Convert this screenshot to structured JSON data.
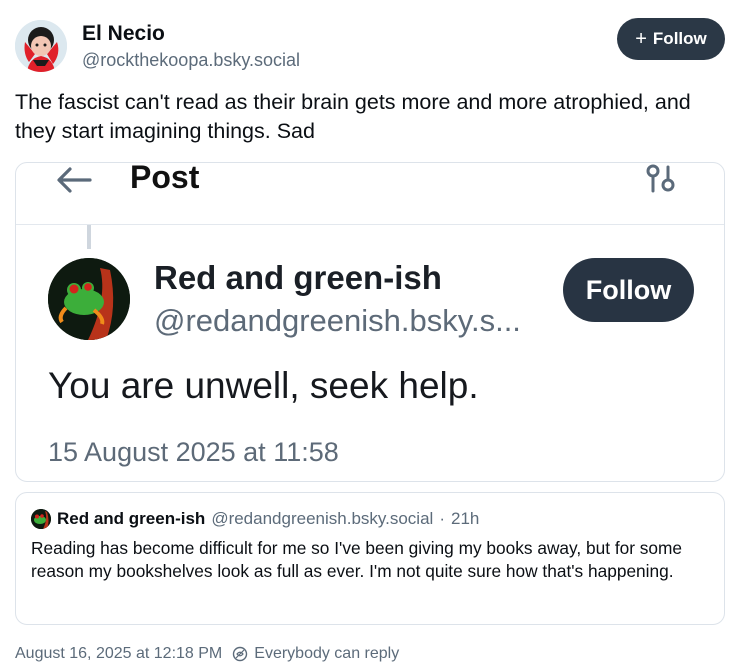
{
  "author": {
    "name": "El Necio",
    "handle": "@rockthekoopa.bsky.social",
    "follow_label": "Follow",
    "follow_plus": "+"
  },
  "post": {
    "text": "The fascist can't read as their brain gets more and more atrophied, and they start imagining things. Sad"
  },
  "embed": {
    "header_title": "Post",
    "name": "Red and green-ish",
    "handle": "@redandgreenish.bsky.s...",
    "follow_label": "Follow",
    "body": "You are unwell, seek help.",
    "date": "15 August 2025 at 11:58"
  },
  "quote": {
    "name": "Red and green-ish",
    "handle": "@redandgreenish.bsky.social",
    "sep": "·",
    "time": "21h",
    "text": "Reading has become difficult for me so I've been giving my books away, but for some reason my bookshelves look as full as ever. I'm not quite sure how that's happening."
  },
  "footer": {
    "timestamp": "August 16, 2025 at 12:18 PM",
    "reply_setting": "Everybody can reply"
  },
  "colors": {
    "follow_button_bg": "#2b3846",
    "secondary_text": "#5c6b7a",
    "border": "#dde3ea"
  },
  "icons": {
    "back": "arrow-left-icon",
    "settings": "sliders-icon",
    "reply": "reply-settings-icon"
  }
}
